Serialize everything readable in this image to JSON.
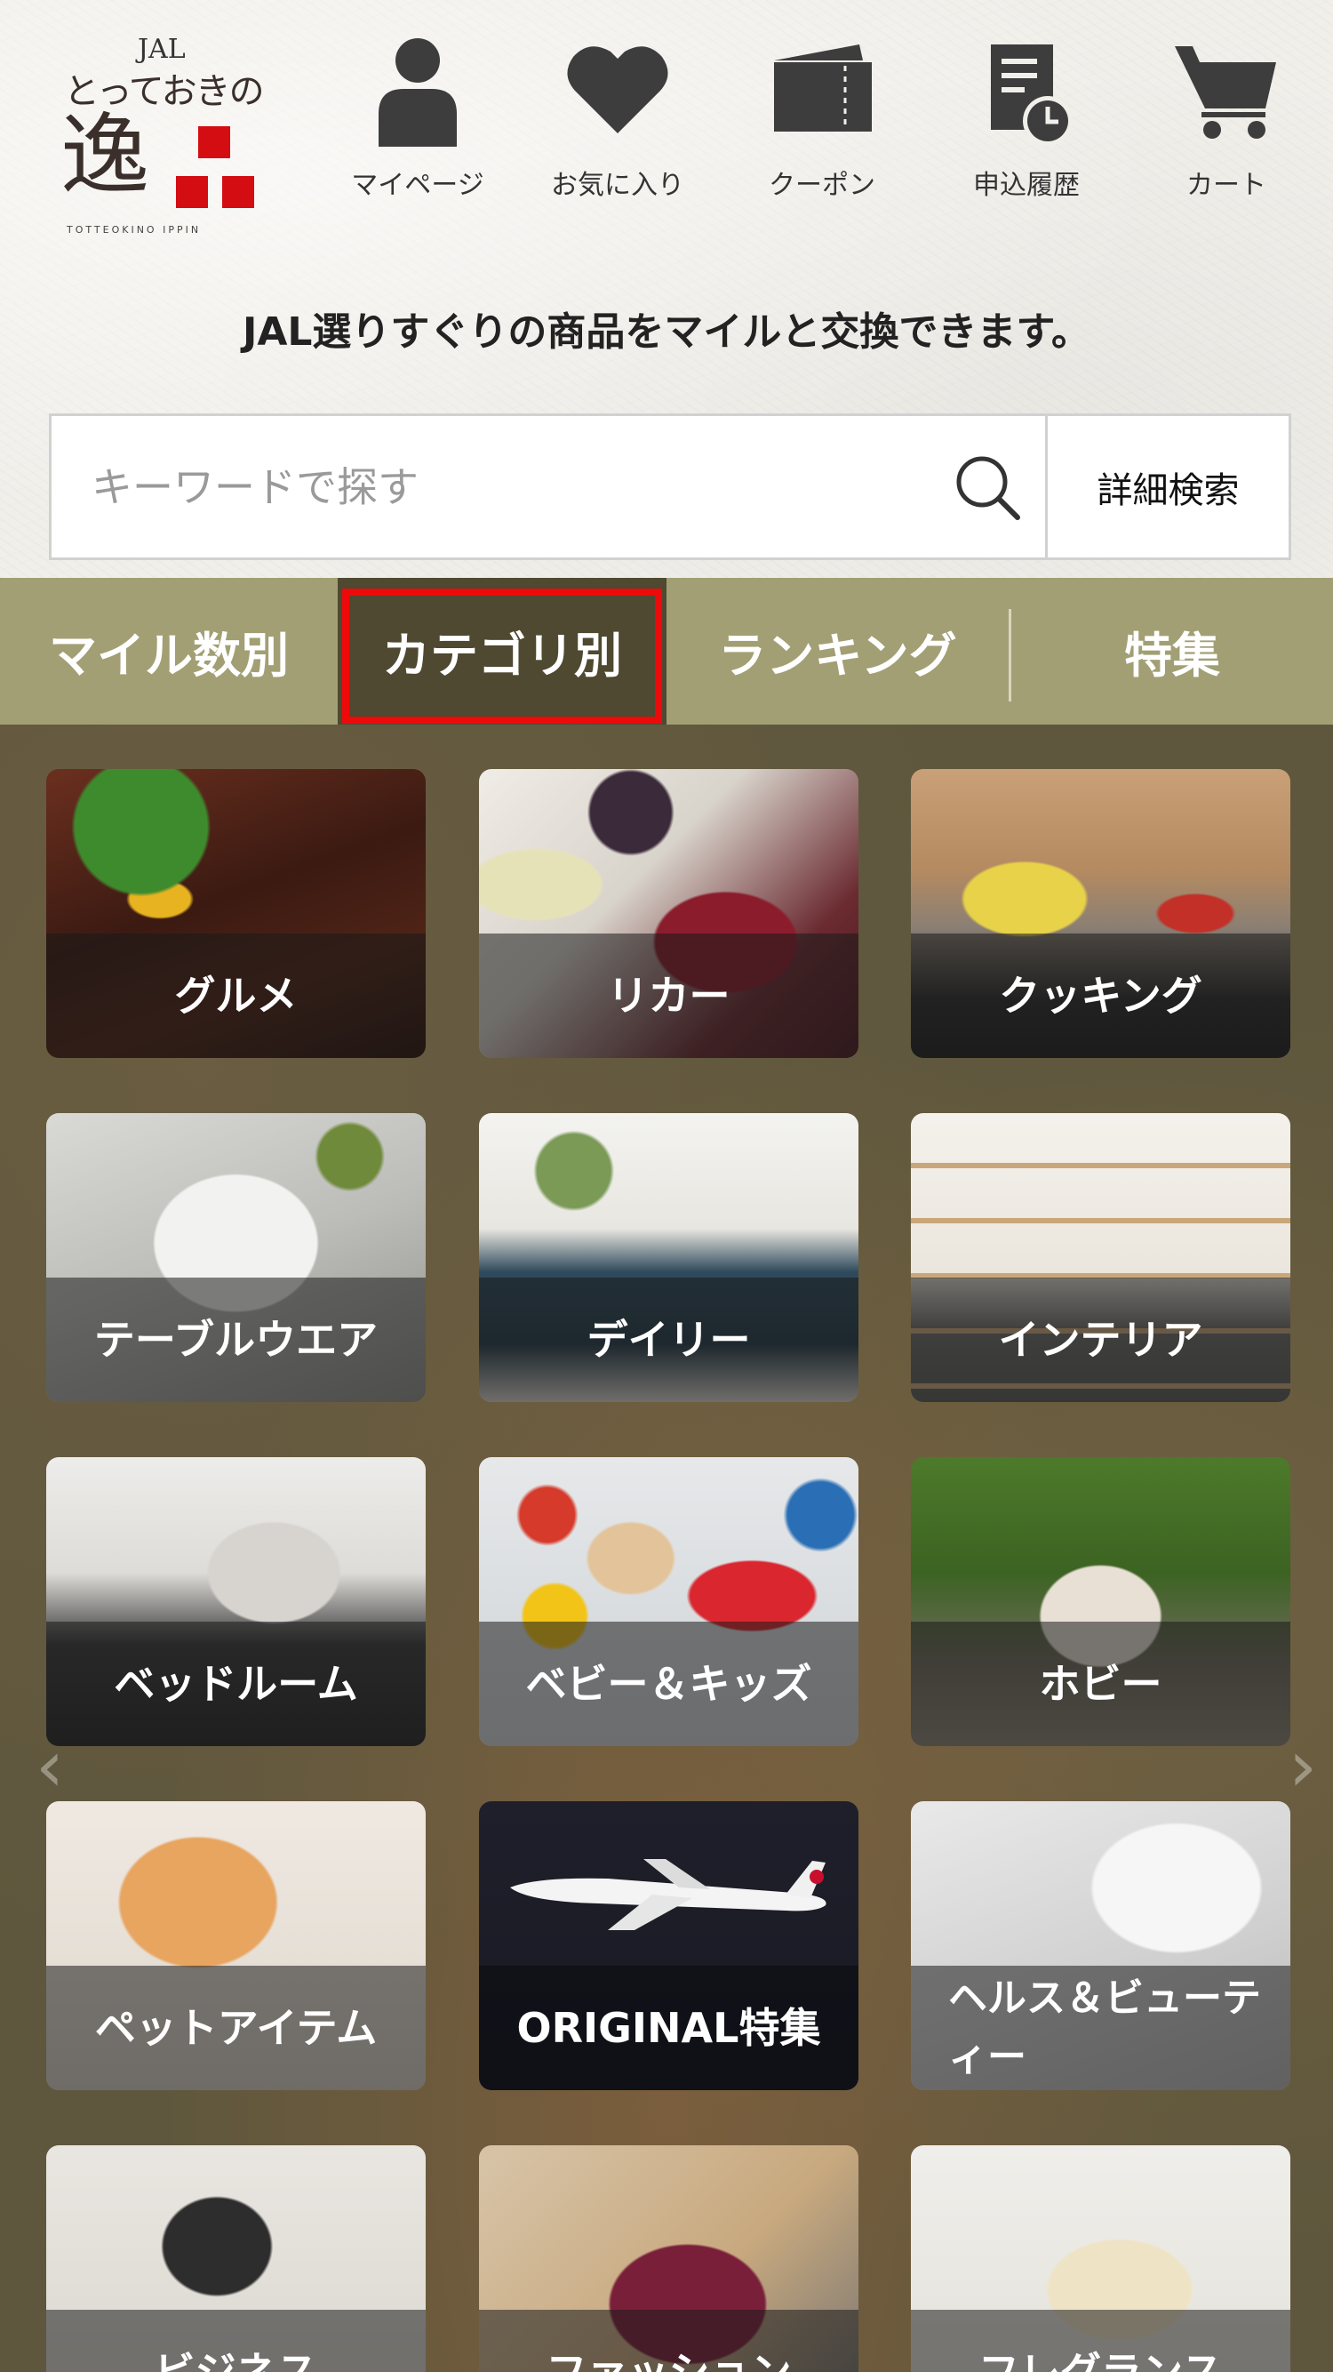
{
  "header": {
    "logo": {
      "jal": "JAL",
      "name": "とっておきの",
      "kanji": "逸",
      "sub": "TOTTEOKINO IPPIN"
    },
    "nav": [
      {
        "label": "マイページ",
        "icon": "person-icon"
      },
      {
        "label": "お気に入り",
        "icon": "heart-icon"
      },
      {
        "label": "クーポン",
        "icon": "coupon-icon"
      },
      {
        "label": "申込履歴",
        "icon": "history-icon"
      },
      {
        "label": "カート",
        "icon": "cart-icon"
      }
    ]
  },
  "tagline": "JAL選りすぐりの商品をマイルと交換できます。",
  "search": {
    "placeholder": "キーワードで探す",
    "advanced_label": "詳細検索"
  },
  "tabs": [
    {
      "label": "マイル数別",
      "active": false
    },
    {
      "label": "カテゴリ別",
      "active": true
    },
    {
      "label": "ランキング",
      "active": false
    },
    {
      "label": "特集",
      "active": false
    }
  ],
  "categories": [
    {
      "label": "グルメ"
    },
    {
      "label": "リカー"
    },
    {
      "label": "クッキング"
    },
    {
      "label": "テーブルウエア"
    },
    {
      "label": "デイリー"
    },
    {
      "label": "インテリア"
    },
    {
      "label": "ベッドルーム"
    },
    {
      "label": "ベビー＆キッズ"
    },
    {
      "label": "ホビー"
    },
    {
      "label": "ペットアイテム"
    },
    {
      "label": "ORIGINAL特集"
    },
    {
      "label": "ヘルス＆ビューティー"
    },
    {
      "label": "ビジネス"
    },
    {
      "label": "ファッション"
    },
    {
      "label": "フレグランス"
    }
  ],
  "colors": {
    "tab_bar": "#a29f74",
    "tab_active": "#4e4930",
    "highlight": "#ee0a0a",
    "logo_red": "#d40d12"
  }
}
